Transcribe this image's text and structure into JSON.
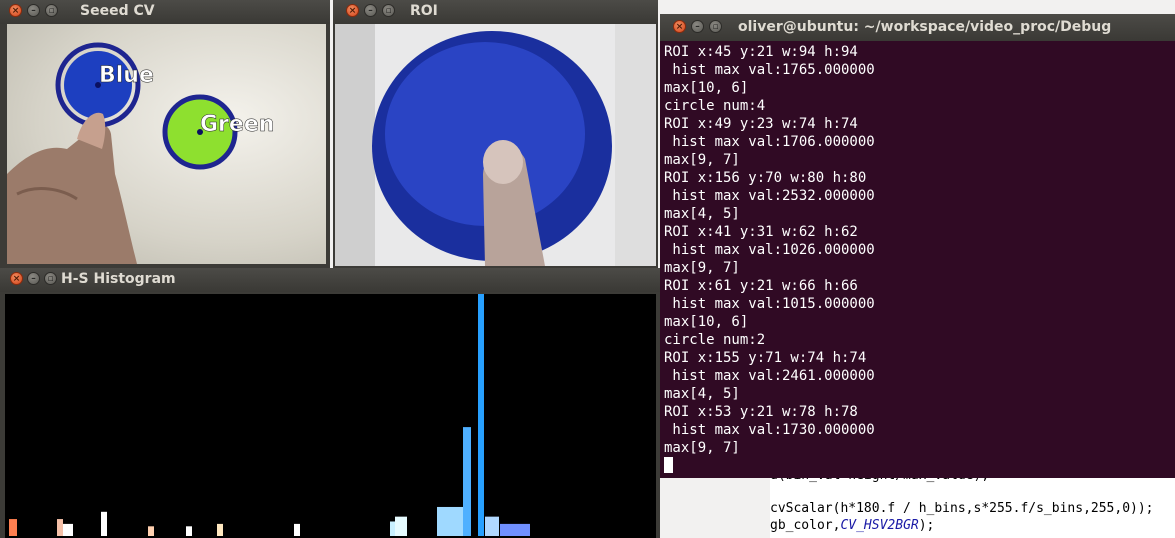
{
  "windows": {
    "seeed": {
      "title": "Seeed CV",
      "labels": {
        "blue": "Blue",
        "green": "Green"
      },
      "colors": {
        "ring": "#1e2590",
        "blue_disc": "#1d3fc0",
        "green_disc": "#8ee02f"
      }
    },
    "roi": {
      "title": "ROI"
    },
    "histogram": {
      "title": "H-S Histogram",
      "bins": [
        {
          "color": "#ff7f50",
          "value": 0.07
        },
        {
          "color": "#f5c0a8",
          "value": 0.07
        },
        {
          "color": "#ffffff",
          "value": 0.05
        },
        {
          "color": "#ffffff",
          "value": 0.1
        },
        {
          "color": "#ffd0b0",
          "value": 0.04
        },
        {
          "color": "#ffffff",
          "value": 0.04
        },
        {
          "color": "#ffe8c0",
          "value": 0.05
        },
        {
          "color": "#ffffff",
          "value": 0.05
        },
        {
          "color": "#c8f0ff",
          "value": 0.06
        },
        {
          "color": "#e6fbff",
          "value": 0.08
        },
        {
          "color": "#9fd9ff",
          "value": 0.12
        },
        {
          "color": "#4fb0ff",
          "value": 0.45
        },
        {
          "color": "#27a0ff",
          "value": 1.0
        },
        {
          "color": "#b0d8ff",
          "value": 0.08
        },
        {
          "color": "#7090ff",
          "value": 0.05
        }
      ]
    },
    "terminal": {
      "title": "oliver@ubuntu: ~/workspace/video_proc/Debug",
      "lines": [
        "ROI x:45 y:21 w:94 h:94",
        " hist max val:1765.000000",
        "max[10, 6]",
        "circle num:4",
        "ROI x:49 y:23 w:74 h:74",
        " hist max val:1706.000000",
        "max[9, 7]",
        "ROI x:156 y:70 w:80 h:80",
        " hist max val:2532.000000",
        "max[4, 5]",
        "ROI x:41 y:31 w:62 h:62",
        " hist max val:1026.000000",
        "max[9, 7]",
        "ROI x:61 y:21 w:66 h:66",
        " hist max val:1015.000000",
        "max[10, 6]",
        "circle num:2",
        "ROI x:155 y:71 w:74 h:74",
        " hist max val:2461.000000",
        "max[4, 5]",
        "ROI x:53 y:21 w:78 h:78",
        " hist max val:1730.000000",
        "max[9, 7]"
      ]
    },
    "editor": {
      "line1": "d(bin_val*height/max_value);",
      "line2": "cvScalar(h*180.f / h_bins,s*255.f/s_bins,255,0));",
      "line3_prefix": "gb_color,",
      "line3_kw": "CV_HSV2BGR",
      "line3_suffix": ");"
    }
  },
  "window_buttons": {
    "close": "×",
    "min": "–",
    "max": "▫"
  }
}
